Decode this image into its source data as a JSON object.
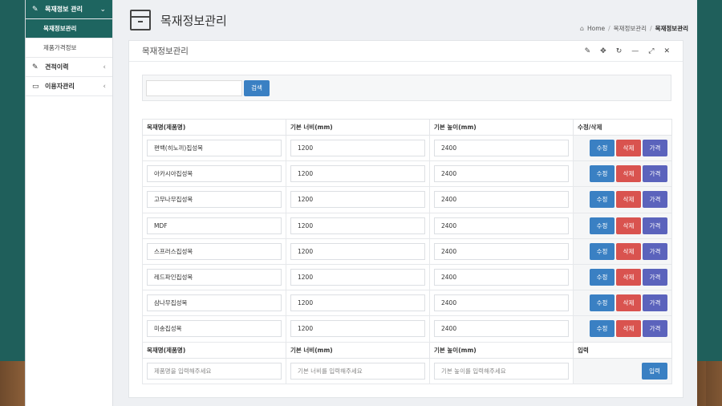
{
  "sidebar": {
    "groups": [
      {
        "label": "목재정보 관리",
        "icon": "edit-icon",
        "chevron": "⌄"
      },
      {
        "label": "견적이력",
        "icon": "edit-icon",
        "chevron": "‹"
      },
      {
        "label": "이용자관리",
        "icon": "calendar-icon",
        "chevron": "‹"
      }
    ],
    "subitems": [
      {
        "label": "목재정보관리"
      },
      {
        "label": "제품가격정보"
      }
    ]
  },
  "page": {
    "title": "목재정보관리",
    "breadcrumb": {
      "home": "Home",
      "parent": "목재정보관리",
      "current": "목재정보관리"
    }
  },
  "panel": {
    "title": "목재정보관리",
    "tools": [
      "pencil-icon",
      "move-icon",
      "refresh-icon",
      "minimize-icon",
      "expand-icon",
      "close-icon"
    ]
  },
  "search": {
    "value": "",
    "placeholder": "",
    "button": "검색"
  },
  "table": {
    "headers": [
      "목재명(제품명)",
      "기본 너비(mm)",
      "기본 높이(mm)",
      "수정/삭제"
    ],
    "rows": [
      {
        "name": "편백(히노끼)집성목",
        "width": "1200",
        "height": "2400"
      },
      {
        "name": "아카시아집성목",
        "width": "1200",
        "height": "2400"
      },
      {
        "name": "고무나무집성목",
        "width": "1200",
        "height": "2400"
      },
      {
        "name": "MDF",
        "width": "1200",
        "height": "2400"
      },
      {
        "name": "스프러스집성목",
        "width": "1200",
        "height": "2400"
      },
      {
        "name": "레드파인집성목",
        "width": "1200",
        "height": "2400"
      },
      {
        "name": "삼나무집성목",
        "width": "1200",
        "height": "2400"
      },
      {
        "name": "미송집성목",
        "width": "1200",
        "height": "2400"
      }
    ],
    "row_buttons": {
      "edit": "수정",
      "delete": "삭제",
      "price": "가격"
    },
    "new_headers": [
      "목재명(제품명)",
      "기본 너비(mm)",
      "기본 높이(mm)",
      "입력"
    ],
    "new_row": {
      "name_placeholder": "제품명을 입력해주세요",
      "width_placeholder": "기본 너비를 입력해주세요",
      "height_placeholder": "기본 높이를 입력해주세요",
      "submit": "입력"
    }
  },
  "colors": {
    "sidebar_active": "#1e6560",
    "blue": "#3a80c3",
    "red": "#d9534f",
    "purple": "#5b63bc"
  }
}
